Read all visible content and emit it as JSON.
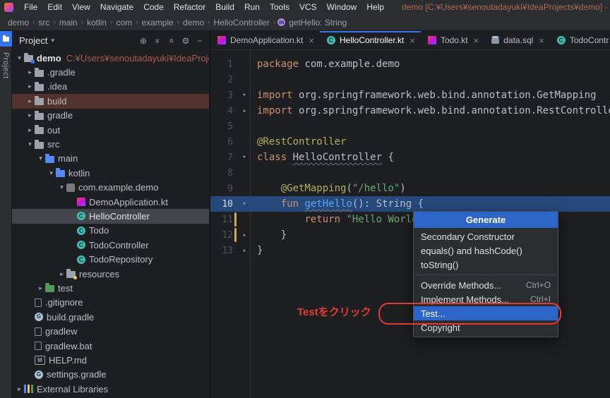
{
  "menubar": {
    "items": [
      "File",
      "Edit",
      "View",
      "Navigate",
      "Code",
      "Refactor",
      "Build",
      "Run",
      "Tools",
      "VCS",
      "Window",
      "Help"
    ],
    "window_title": "demo [C:¥Users¥senoutadayuki¥IdeaProjects¥demo] - Hello..."
  },
  "breadcrumbs": {
    "items": [
      "demo",
      "src",
      "main",
      "kotlin",
      "com",
      "example",
      "demo",
      "HelloController"
    ],
    "method": "getHello: String"
  },
  "activity_bar": {
    "project_label": "Project"
  },
  "project_panel": {
    "title": "Project",
    "header_icons": [
      "locate",
      "expand-all",
      "collapse-all",
      "settings",
      "hide"
    ],
    "tree": [
      {
        "label": "demo",
        "suffix": "C:¥Users¥senoutadayuki¥IdeaProjects¥demo",
        "level": 0,
        "arrow": "expanded",
        "icon": "project-folder",
        "bold": true
      },
      {
        "label": ".gradle",
        "level": 1,
        "arrow": "collapsed",
        "icon": "folder"
      },
      {
        "label": ".idea",
        "level": 1,
        "arrow": "collapsed",
        "icon": "folder"
      },
      {
        "label": "build",
        "level": 1,
        "arrow": "collapsed",
        "icon": "folder",
        "row": "excluded"
      },
      {
        "label": "gradle",
        "level": 1,
        "arrow": "collapsed",
        "icon": "folder"
      },
      {
        "label": "out",
        "level": 1,
        "arrow": "collapsed",
        "icon": "folder"
      },
      {
        "label": "src",
        "level": 1,
        "arrow": "expanded",
        "icon": "folder"
      },
      {
        "label": "main",
        "level": 2,
        "arrow": "expanded",
        "icon": "folder-src"
      },
      {
        "label": "kotlin",
        "level": 3,
        "arrow": "expanded",
        "icon": "folder-src"
      },
      {
        "label": "com.example.demo",
        "level": 4,
        "arrow": "expanded",
        "icon": "package"
      },
      {
        "label": "DemoApplication.kt",
        "level": 5,
        "icon": "kotlin-file"
      },
      {
        "label": "HelloController",
        "level": 5,
        "icon": "spring-class",
        "row": "selected"
      },
      {
        "label": "Todo",
        "level": 5,
        "icon": "spring-class"
      },
      {
        "label": "TodoController",
        "level": 5,
        "icon": "spring-class"
      },
      {
        "label": "TodoRepository",
        "level": 5,
        "icon": "spring-class"
      },
      {
        "label": "resources",
        "level": 4,
        "arrow": "collapsed",
        "icon": "folder-resources"
      },
      {
        "label": "test",
        "level": 2,
        "arrow": "collapsed",
        "icon": "folder-test"
      },
      {
        "label": ".gitignore",
        "level": 1,
        "icon": "file"
      },
      {
        "label": "build.gradle",
        "level": 1,
        "icon": "gradle"
      },
      {
        "label": "gradlew",
        "level": 1,
        "icon": "file"
      },
      {
        "label": "gradlew.bat",
        "level": 1,
        "icon": "file"
      },
      {
        "label": "HELP.md",
        "level": 1,
        "icon": "markdown"
      },
      {
        "label": "settings.gradle",
        "level": 1,
        "icon": "gradle"
      },
      {
        "label": "External Libraries",
        "level": 0,
        "arrow": "collapsed",
        "icon": "libraries"
      }
    ]
  },
  "editor": {
    "close_glyph": "×",
    "tabs": [
      {
        "label": "DemoApplication.kt",
        "icon": "kotlin-file",
        "active": false
      },
      {
        "label": "HelloController.kt",
        "icon": "spring-class",
        "active": true
      },
      {
        "label": "Todo.kt",
        "icon": "kotlin-file",
        "active": false
      },
      {
        "label": "data.sql",
        "icon": "sql-file",
        "active": false
      },
      {
        "label": "TodoContr",
        "icon": "spring-class",
        "active": false
      }
    ],
    "lines": [
      {
        "n": 1,
        "seg": [
          [
            "kw",
            "package "
          ],
          [
            "pl",
            "com.example.demo"
          ]
        ]
      },
      {
        "n": 2,
        "seg": []
      },
      {
        "n": 3,
        "seg": [
          [
            "kw",
            "import "
          ],
          [
            "pl",
            "org.springframework.web.bind.annotation.GetMapping"
          ]
        ],
        "fold": "down"
      },
      {
        "n": 4,
        "seg": [
          [
            "kw",
            "import "
          ],
          [
            "pl",
            "org.springframework.web.bind.annotation.RestController"
          ]
        ],
        "fold": "up"
      },
      {
        "n": 5,
        "seg": []
      },
      {
        "n": 6,
        "seg": [
          [
            "ann",
            "@RestController"
          ]
        ]
      },
      {
        "n": 7,
        "seg": [
          [
            "kw",
            "class "
          ],
          [
            "decl",
            "HelloController"
          ],
          [
            "pl",
            " {"
          ]
        ],
        "fold": "down"
      },
      {
        "n": 8,
        "seg": []
      },
      {
        "n": 9,
        "seg": [
          [
            "pl",
            "    "
          ],
          [
            "ann",
            "@GetMapping"
          ],
          [
            "pl",
            "("
          ],
          [
            "str",
            "\"/hello\""
          ],
          [
            "pl",
            ")"
          ]
        ]
      },
      {
        "n": 10,
        "seg": [
          [
            "pl",
            "    "
          ],
          [
            "kw",
            "fun "
          ],
          [
            "fn",
            "getHello"
          ],
          [
            "pl",
            "(): String {"
          ]
        ],
        "fold": "down",
        "caret": true
      },
      {
        "n": 11,
        "seg": [
          [
            "pl",
            "        "
          ],
          [
            "kw",
            "return "
          ],
          [
            "str",
            "\"Hello World!\""
          ]
        ],
        "changed": true
      },
      {
        "n": 12,
        "seg": [
          [
            "pl",
            "    }"
          ]
        ],
        "fold": "up",
        "changed": true
      },
      {
        "n": 13,
        "seg": [
          [
            "pl",
            "}"
          ]
        ],
        "fold": "up"
      }
    ]
  },
  "generate_popup": {
    "title": "Generate",
    "items": [
      {
        "label": "Secondary Constructor"
      },
      {
        "label": "equals() and hashCode()"
      },
      {
        "label": "toString()"
      },
      {
        "separator": true
      },
      {
        "label": "Override Methods...",
        "shortcut": "Ctrl+O"
      },
      {
        "label": "Implement Methods...",
        "shortcut": "Ctrl+I"
      },
      {
        "label": "Test...",
        "selected": true
      },
      {
        "label": "Copyright"
      }
    ]
  },
  "annotation": {
    "text": "Testをクリック"
  }
}
